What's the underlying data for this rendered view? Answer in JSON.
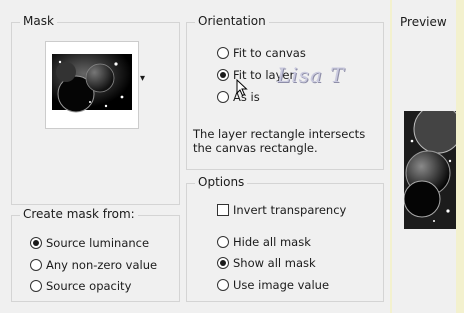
{
  "mask": {
    "title": "Mask",
    "dropdown_arrow": "▾"
  },
  "create_mask": {
    "title": "Create mask from:",
    "options": [
      "Source luminance",
      "Any non-zero value",
      "Source opacity"
    ],
    "selected": 0
  },
  "orientation": {
    "title": "Orientation",
    "options": [
      "Fit to canvas",
      "Fit to layer",
      "As is"
    ],
    "selected": 1,
    "description": "The layer rectangle intersects the canvas rectangle."
  },
  "options": {
    "title": "Options",
    "invert_label": "Invert transparency",
    "invert_checked": false,
    "radios": [
      "Hide all mask",
      "Show all mask",
      "Use image value"
    ],
    "selected": 1
  },
  "preview": {
    "title": "Preview"
  },
  "watermark": "Lisa T",
  "colors": {
    "panel_bg": "#f0f0f0",
    "outer_bg": "#f3f1ce",
    "watermark": "#d9d9e8"
  }
}
